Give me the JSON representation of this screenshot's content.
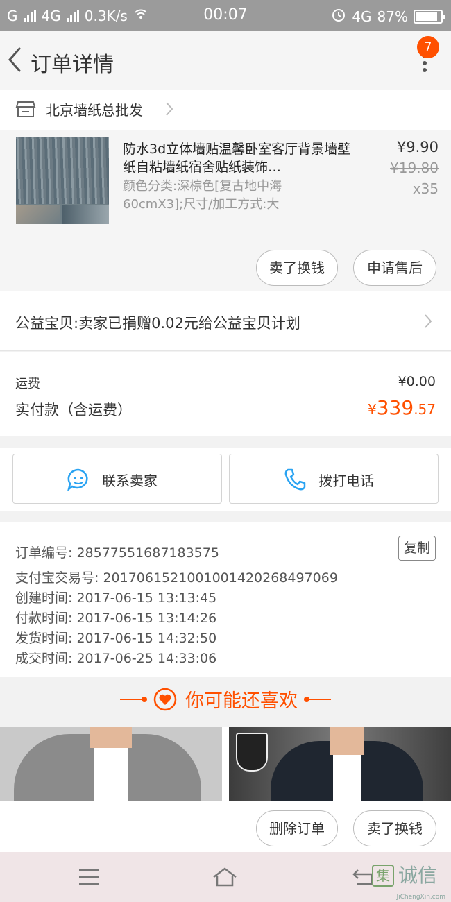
{
  "status_bar": {
    "carrier": "G",
    "network1": "4G",
    "speed": "0.3K/s",
    "time": "00:07",
    "network2": "4G",
    "battery": "87%",
    "battery_level": 0.87
  },
  "nav": {
    "title": "订单详情",
    "badge": "7"
  },
  "shop": {
    "name": "北京墙纸总批发"
  },
  "item": {
    "title": "防水3d立体墙贴温馨卧室客厅背景墙壁纸自粘墙纸宿舍贴纸装饰…",
    "sku": "颜色分类:深棕色[复古地中海60cmX3];尺寸/加工方式:大",
    "price": "¥9.90",
    "original_price": "¥19.80",
    "quantity": "x35",
    "sell_button": "卖了换钱",
    "aftersale_button": "申请售后"
  },
  "charity": {
    "text": "公益宝贝:卖家已捐赠0.02元给公益宝贝计划"
  },
  "totals": {
    "shipping_label": "运费",
    "shipping_value": "¥0.00",
    "paid_label": "实付款（含运费）",
    "paid_currency": "¥",
    "paid_integer": "339",
    "paid_decimal": ".57"
  },
  "contact": {
    "seller_button": "联系卖家",
    "call_button": "拨打电话"
  },
  "order_info": {
    "order_no": "订单编号: 28577551687183575",
    "copy_button": "复制",
    "alipay_no": "支付宝交易号: 2017061521001001420268497069",
    "created": "创建时间: 2017-06-15 13:13:45",
    "paid": "付款时间: 2017-06-15 13:14:26",
    "shipped": "发货时间: 2017-06-15 14:32:50",
    "completed": "成交时间: 2017-06-25 14:33:06"
  },
  "recommend": {
    "title": "你可能还喜欢"
  },
  "bottom": {
    "delete_button": "删除订单",
    "sell_button": "卖了换钱"
  },
  "watermark": {
    "logo": "集",
    "brand": "诚信",
    "url": "JiChengXin.com"
  },
  "colors": {
    "accent": "#ff5000",
    "status_bar": "#9b9b9b",
    "contact_icon": "#29a3f2"
  }
}
